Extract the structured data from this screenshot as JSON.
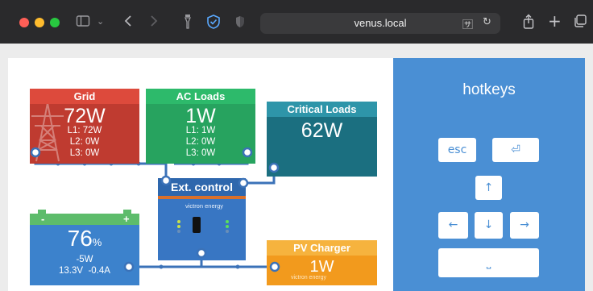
{
  "browser": {
    "url": "venus.local",
    "icons": [
      "sidebar-icon",
      "chevron-down-icon",
      "back-icon",
      "forward-icon",
      "lantern-icon",
      "shield-check-icon",
      "privacy-shield-icon",
      "translate-icon",
      "reload-icon",
      "share-icon",
      "new-tab-icon",
      "tabs-icon"
    ]
  },
  "overview": {
    "grid": {
      "title": "Grid",
      "power": "72W",
      "l1": "L1: 72W",
      "l2": "L2: 0W",
      "l3": "L3: 0W"
    },
    "ac_loads": {
      "title": "AC Loads",
      "power": "1W",
      "l1": "L1: 1W",
      "l2": "L2: 0W",
      "l3": "L3: 0W"
    },
    "critical_loads": {
      "title": "Critical Loads",
      "power": "62W"
    },
    "inverter": {
      "title": "Ext. control",
      "brand": "victron energy"
    },
    "battery": {
      "soc": "76",
      "soc_unit": "%",
      "power": "-5W",
      "voltage": "13.3V",
      "current": "-0.4A",
      "minus": "-",
      "plus": "+"
    },
    "pv": {
      "title": "PV Charger",
      "power": "1W",
      "brand": "victron energy"
    }
  },
  "hotkeys": {
    "title": "hotkeys",
    "esc": "esc",
    "enter": "⏎",
    "up": "↑",
    "left": "←",
    "down": "↓",
    "right": "→",
    "space": "⎵"
  },
  "colors": {
    "grid": "#bf3b30",
    "ac_loads": "#27a35f",
    "critical_loads": "#1b6f80",
    "battery": "#3c82cc",
    "inverter": "#3876c3",
    "pv": "#f29a1d",
    "hotkeys_panel": "#4a8fd4",
    "wire": "#3b72b8"
  }
}
